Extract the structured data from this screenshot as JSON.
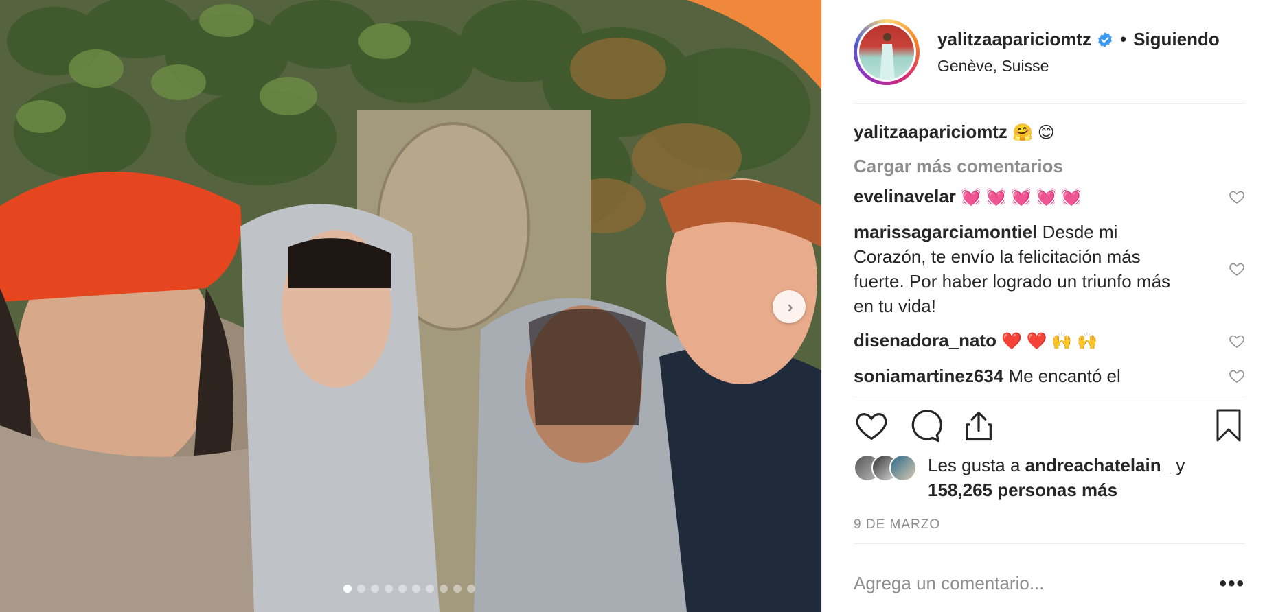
{
  "post": {
    "carousel": {
      "slide_count": 10,
      "active_index": 0
    },
    "photo_alt": "Group selfie of four people in front of ivy and a stone wall"
  },
  "header": {
    "username": "yalitzaapariciomtz",
    "verified": true,
    "bullet": "•",
    "follow_status": "Siguiendo",
    "location": "Genève, Suisse"
  },
  "caption": {
    "username": "yalitzaapariciomtz",
    "text": "🤗 😊"
  },
  "load_more_label": "Cargar más comentarios",
  "comments": [
    {
      "username": "evelinavelar",
      "text": "💓 💓 💓 💓 💓"
    },
    {
      "username": "marissagarciamontiel",
      "text": "Desde mi Corazón, te envío la felicitación más fuerte. Por haber logrado un triunfo más en tu vida!"
    },
    {
      "username": "disenadora_nato",
      "text": "❤️ ❤️ 🙌 🙌"
    },
    {
      "username": "soniamartinez634",
      "text": "Me encantó el"
    }
  ],
  "likes": {
    "prefix": "Les gusta a ",
    "user": "andreachatelain_",
    "suffix": " y",
    "count_text": "158,265 personas más"
  },
  "date": "9 DE MARZO",
  "add_comment": {
    "placeholder": "Agrega un comentario..."
  },
  "colors": {
    "accent": "#3897f0",
    "muted": "#8e8e8e",
    "text": "#262626"
  }
}
